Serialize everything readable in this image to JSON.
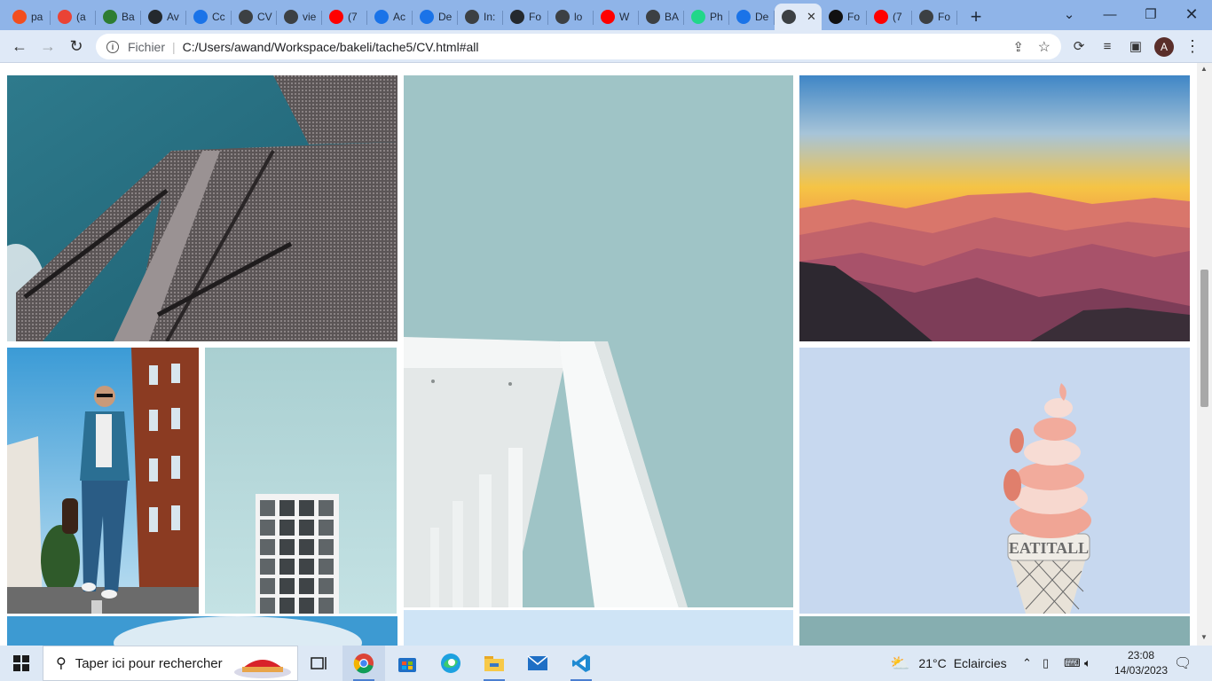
{
  "browser": {
    "tabs": [
      {
        "label": "pa",
        "icon": "figma-icon",
        "color": "#f24e1e"
      },
      {
        "label": "(a",
        "icon": "gmail-icon",
        "color": "#ea4335"
      },
      {
        "label": "Ba",
        "icon": "bakeli-icon",
        "color": "#2e7d32"
      },
      {
        "label": "Av",
        "icon": "github-icon",
        "color": "#24292e"
      },
      {
        "label": "Cc",
        "icon": "chrome-c-icon",
        "color": "#1a73e8"
      },
      {
        "label": "CV",
        "icon": "globe-icon",
        "color": "#3c4043"
      },
      {
        "label": "vie",
        "icon": "globe-icon",
        "color": "#3c4043"
      },
      {
        "label": "(7",
        "icon": "youtube-icon",
        "color": "#ff0000"
      },
      {
        "label": "Ac",
        "icon": "chrome-c-icon",
        "color": "#1a73e8"
      },
      {
        "label": "De",
        "icon": "chrome-c-icon",
        "color": "#1a73e8"
      },
      {
        "label": "In:",
        "icon": "globe-icon",
        "color": "#3c4043"
      },
      {
        "label": "Fo",
        "icon": "github-icon",
        "color": "#24292e"
      },
      {
        "label": "lo",
        "icon": "globe-icon",
        "color": "#3c4043"
      },
      {
        "label": "W",
        "icon": "youtube-icon",
        "color": "#ff0000"
      },
      {
        "label": "BA",
        "icon": "globe-icon",
        "color": "#3c4043"
      },
      {
        "label": "Ph",
        "icon": "pycharm-icon",
        "color": "#21d789"
      },
      {
        "label": "De",
        "icon": "chrome-c-icon",
        "color": "#1a73e8"
      },
      {
        "label": "",
        "icon": "globe-icon",
        "color": "#3c4043",
        "active": true
      },
      {
        "label": "Fo",
        "icon": "flag-icon",
        "color": "#111111"
      },
      {
        "label": "(7",
        "icon": "youtube-icon",
        "color": "#ff0000"
      },
      {
        "label": "Fo",
        "icon": "globe-icon",
        "color": "#3c4043"
      }
    ],
    "new_tab": "+",
    "address": {
      "scheme_label": "Fichier",
      "url": "C:/Users/awand/Workspace/bakeli/tache5/CV.html#all"
    },
    "profile_initial": "A"
  },
  "gallery": {
    "photos": [
      {
        "name": "photo-brick-building"
      },
      {
        "name": "photo-white-canopy"
      },
      {
        "name": "photo-mountain-sunset"
      },
      {
        "name": "photo-walking-man"
      },
      {
        "name": "photo-window-tower"
      },
      {
        "name": "photo-ice-cream-sign"
      },
      {
        "name": "photo-sky-partial"
      },
      {
        "name": "photo-blue-partial"
      },
      {
        "name": "photo-teal-partial"
      }
    ],
    "sign_text": "EATITALL"
  },
  "taskbar": {
    "search_placeholder": "Taper ici pour rechercher",
    "weather": {
      "temp": "21°C",
      "condition": "Eclaircies"
    },
    "time": "23:08",
    "date": "14/03/2023"
  }
}
